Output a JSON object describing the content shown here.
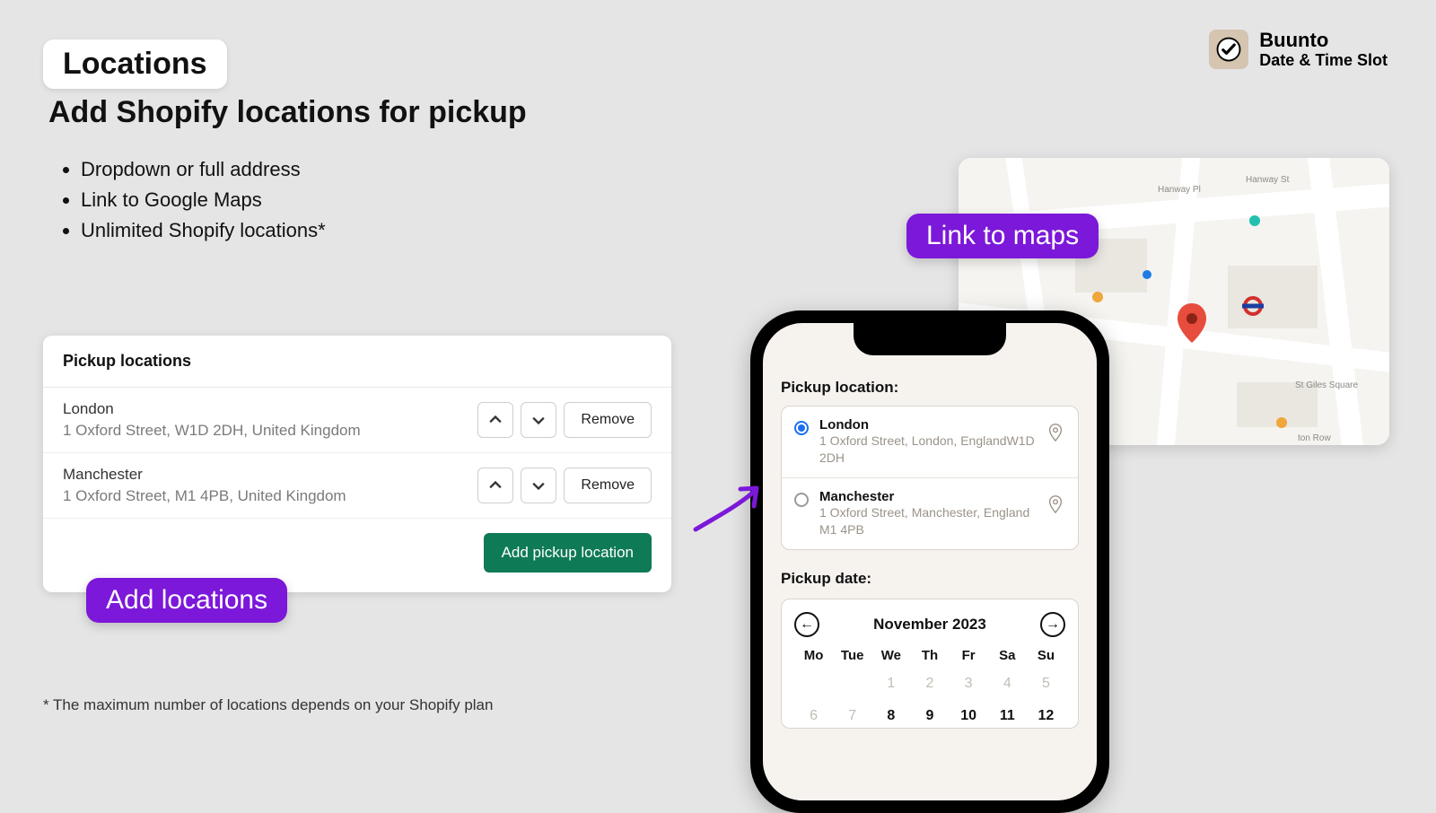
{
  "brand": {
    "name": "Buunto",
    "tagline": "Date & Time Slot"
  },
  "heading": {
    "badge": "Locations",
    "title": "Add Shopify locations for pickup",
    "bullets": [
      "Dropdown or full address",
      "Link to Google Maps",
      "Unlimited Shopify locations*"
    ]
  },
  "admin": {
    "panel_title": "Pickup locations",
    "rows": [
      {
        "name": "London",
        "address": "1 Oxford Street, W1D 2DH, United Kingdom"
      },
      {
        "name": "Manchester",
        "address": "1 Oxford Street, M1 4PB, United Kingdom"
      }
    ],
    "remove_label": "Remove",
    "add_label": "Add pickup location"
  },
  "callouts": {
    "add_locations": "Add locations",
    "link_to_maps": "Link to maps"
  },
  "phone": {
    "pickup_location_label": "Pickup location:",
    "options": [
      {
        "city": "London",
        "address": "1 Oxford Street, London, EnglandW1D 2DH",
        "selected": true
      },
      {
        "city": "Manchester",
        "address": "1 Oxford Street, Manchester, England M1 4PB",
        "selected": false
      }
    ],
    "pickup_date_label": "Pickup date:",
    "calendar": {
      "month": "November 2023",
      "dow": [
        "Mo",
        "Tue",
        "We",
        "Th",
        "Fr",
        "Sa",
        "Su"
      ],
      "week1": [
        "",
        "",
        "1",
        "2",
        "3",
        "4",
        "5"
      ],
      "week2": [
        "6",
        "7",
        "8",
        "9",
        "10",
        "11",
        "12"
      ]
    }
  },
  "footnote": "* The maximum number of locations depends on your Shopify plan"
}
